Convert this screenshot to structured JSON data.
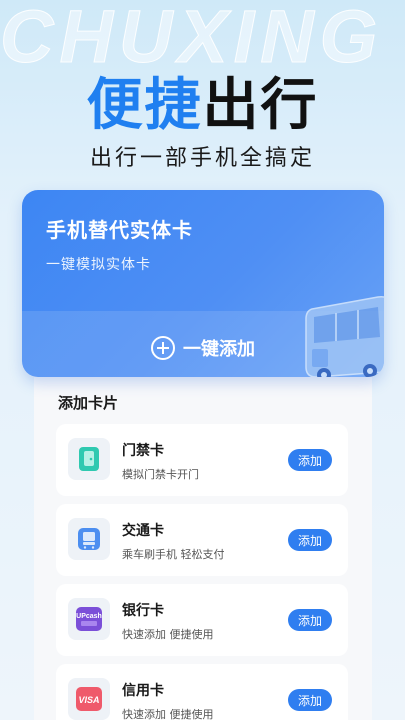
{
  "watermark": "CHUXING",
  "hero": {
    "title_blue": "便捷",
    "title_dark": "出行",
    "subtitle": "出行一部手机全搞定"
  },
  "card": {
    "title": "手机替代实体卡",
    "subtitle": "一键模拟实体卡",
    "action_label": "一键添加"
  },
  "section": {
    "title": "添加卡片"
  },
  "items": [
    {
      "name": "门禁卡",
      "desc": "模拟门禁卡开门",
      "button": "添加",
      "icon": "door-card-icon"
    },
    {
      "name": "交通卡",
      "desc": "乘车刷手机 轻松支付",
      "button": "添加",
      "icon": "bus-icon"
    },
    {
      "name": "银行卡",
      "desc": "快速添加 便捷使用",
      "button": "添加",
      "icon": "unionpay-card-icon",
      "icon_text": "UPcash"
    },
    {
      "name": "信用卡",
      "desc": "快速添加 便捷使用",
      "button": "添加",
      "icon": "visa-card-icon",
      "icon_text": "VISA"
    }
  ],
  "colors": {
    "accent": "#2f7ef0",
    "title_blue": "#1f7ff0"
  }
}
